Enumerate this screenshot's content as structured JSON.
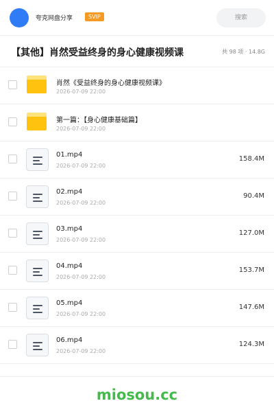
{
  "header": {
    "app_name": "夸克网盘分享",
    "badge": "SVIP",
    "search_label": "搜索"
  },
  "title_bar": {
    "title": "【其他】肖然受益终身的身心健康视频课",
    "meta": "共 98 项 · 14.8G"
  },
  "items": [
    {
      "type": "folder",
      "name": "肖然《受益终身的身心健康视频课》",
      "date": "2026-07-09 22:00",
      "size": ""
    },
    {
      "type": "folder",
      "name": "第一篇：【身心健康基础篇】",
      "date": "2026-07-09 22:00",
      "size": ""
    },
    {
      "type": "file",
      "name": "01.mp4",
      "date": "2026-07-09 22:00",
      "size": "158.4M"
    },
    {
      "type": "file",
      "name": "02.mp4",
      "date": "2026-07-09 22:00",
      "size": "90.4M"
    },
    {
      "type": "file",
      "name": "03.mp4",
      "date": "2026-07-09 22:00",
      "size": "127.0M"
    },
    {
      "type": "file",
      "name": "04.mp4",
      "date": "2026-07-09 22:00",
      "size": "153.7M"
    },
    {
      "type": "file",
      "name": "05.mp4",
      "date": "2026-07-09 22:00",
      "size": "147.6M"
    },
    {
      "type": "file",
      "name": "06.mp4",
      "date": "2026-07-09 22:00",
      "size": "124.3M"
    }
  ],
  "footer": {
    "logo_text": "miosou.cc"
  },
  "colors": {
    "avatar": "#2f7cf6",
    "badge": "#f59a23",
    "folder": "#ffc20e",
    "footer_logo": "#46b94d"
  }
}
